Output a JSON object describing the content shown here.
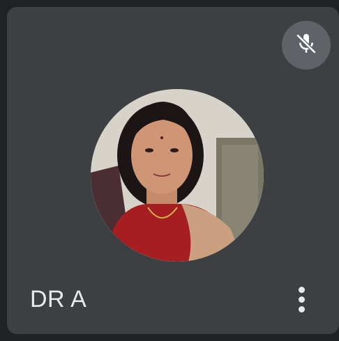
{
  "participant": {
    "name": "DR A",
    "avatar_icon": "participant-photo",
    "mic_state_icon": "mic-off-icon",
    "menu_icon": "more-vert-icon"
  },
  "colors": {
    "background": "#202124",
    "tile": "#3c4043",
    "badge": "#5f6368",
    "text": "#e8eaed"
  }
}
